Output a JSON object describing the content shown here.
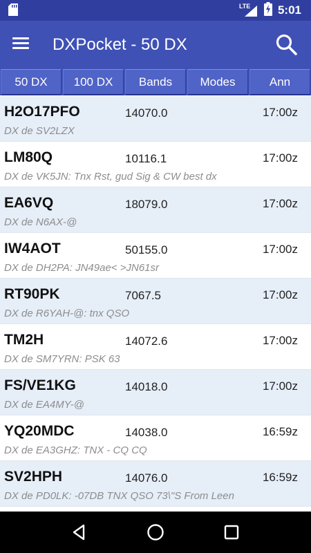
{
  "status_bar": {
    "time": "5:01",
    "network_label": "LTE",
    "icons": [
      "sd-card-icon",
      "signal-icon",
      "battery-charging-icon"
    ]
  },
  "app_bar": {
    "title": "DXPocket - 50 DX",
    "menu_icon": "menu-icon",
    "search_icon": "search-icon"
  },
  "tabs": [
    {
      "label": "50 DX"
    },
    {
      "label": "100 DX"
    },
    {
      "label": "Bands"
    },
    {
      "label": "Modes"
    },
    {
      "label": "Ann"
    }
  ],
  "spots": [
    {
      "callsign": "H2O17PFO",
      "freq": "14070.0",
      "time": "17:00z",
      "info": "DX de SV2LZX"
    },
    {
      "callsign": "LM80Q",
      "freq": "10116.1",
      "time": "17:00z",
      "info": "DX de VK5JN: Tnx Rst, gud Sig & CW best dx"
    },
    {
      "callsign": "EA6VQ",
      "freq": "18079.0",
      "time": "17:00z",
      "info": "DX de N6AX-@"
    },
    {
      "callsign": "IW4AOT",
      "freq": "50155.0",
      "time": "17:00z",
      "info": "DX de DH2PA: JN49ae< >JN61sr"
    },
    {
      "callsign": "RT90PK",
      "freq": "7067.5",
      "time": "17:00z",
      "info": "DX de R6YAH-@: tnx QSO"
    },
    {
      "callsign": "TM2H",
      "freq": "14072.6",
      "time": "17:00z",
      "info": "DX de SM7YRN: PSK 63"
    },
    {
      "callsign": "FS/VE1KG",
      "freq": "14018.0",
      "time": "17:00z",
      "info": "DX de EA4MY-@"
    },
    {
      "callsign": "YQ20MDC",
      "freq": "14038.0",
      "time": "16:59z",
      "info": "DX de EA3GHZ: TNX - CQ CQ"
    },
    {
      "callsign": "SV2HPH",
      "freq": "14076.0",
      "time": "16:59z",
      "info": "DX de PD0LK: -07DB TNX  QSO 73\\\"S From Leen"
    }
  ],
  "nav_bar": {
    "icons": [
      "back-icon",
      "home-icon",
      "recents-icon"
    ]
  },
  "colors": {
    "status_bar": "#303f9f",
    "app_bar": "#3f51b5",
    "tab": "#5063c7",
    "row_alt": "#e6eef8",
    "info_text": "#8d8d8d"
  }
}
